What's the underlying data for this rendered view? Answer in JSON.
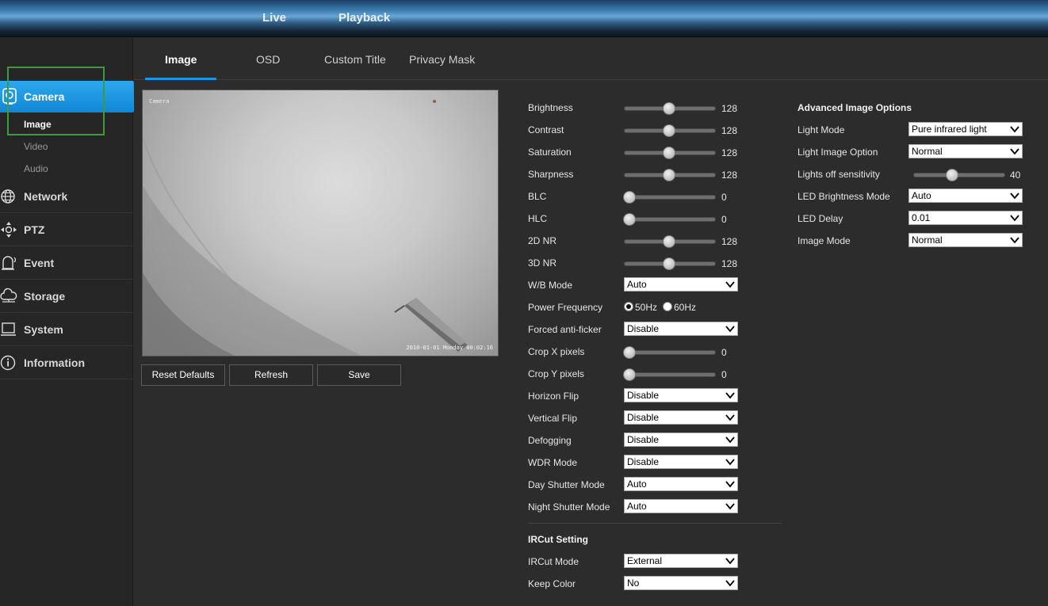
{
  "topnav": {
    "live": "Live",
    "playback": "Playback"
  },
  "sidebar": {
    "camera": "Camera",
    "camera_sub": [
      "Image",
      "Video",
      "Audio"
    ],
    "items": [
      "Network",
      "PTZ",
      "Event",
      "Storage",
      "System",
      "Information"
    ]
  },
  "tabs": [
    "Image",
    "OSD",
    "Custom Title",
    "Privacy Mask"
  ],
  "preview": {
    "osd_name": "Camera",
    "osd_time": "2010-01-01 Monday 00:02:16"
  },
  "buttons": {
    "reset": "Reset Defaults",
    "refresh": "Refresh",
    "save": "Save"
  },
  "sliders": [
    {
      "label": "Brightness",
      "value": "128",
      "fraction": 0.5
    },
    {
      "label": "Contrast",
      "value": "128",
      "fraction": 0.5
    },
    {
      "label": "Saturation",
      "value": "128",
      "fraction": 0.5
    },
    {
      "label": "Sharpness",
      "value": "128",
      "fraction": 0.5
    },
    {
      "label": "BLC",
      "value": "0",
      "fraction": 0
    },
    {
      "label": "HLC",
      "value": "0",
      "fraction": 0
    },
    {
      "label": "2D NR",
      "value": "128",
      "fraction": 0.5
    },
    {
      "label": "3D NR",
      "value": "128",
      "fraction": 0.5
    }
  ],
  "wb": {
    "label": "W/B Mode",
    "value": "Auto"
  },
  "power": {
    "label": "Power Frequency",
    "opt1": "50Hz",
    "opt2": "60Hz",
    "selected": "50Hz"
  },
  "antiflicker": {
    "label": "Forced anti-ficker",
    "value": "Disable"
  },
  "crop": [
    {
      "label": "Crop X pixels",
      "value": "0",
      "fraction": 0
    },
    {
      "label": "Crop Y pixels",
      "value": "0",
      "fraction": 0
    }
  ],
  "selects": [
    {
      "label": "Horizon Flip",
      "value": "Disable"
    },
    {
      "label": "Vertical Flip",
      "value": "Disable"
    },
    {
      "label": "Defogging",
      "value": "Disable"
    },
    {
      "label": "WDR Mode",
      "value": "Disable"
    },
    {
      "label": "Day Shutter Mode",
      "value": "Auto"
    },
    {
      "label": "Night Shutter Mode",
      "value": "Auto"
    }
  ],
  "ircut": {
    "title": "IRCut Setting",
    "mode_label": "IRCut Mode",
    "mode_value": "External",
    "color_label": "Keep Color",
    "color_value": "No"
  },
  "advanced": {
    "title": "Advanced Image Options",
    "light_mode_label": "Light Mode",
    "light_mode_value": "Pure infrared light",
    "light_image_label": "Light Image Option",
    "light_image_value": "Normal",
    "sensitivity_label": "Lights off sensitivity",
    "sensitivity_value": "40",
    "sensitivity_fraction": 0.4,
    "led_mode_label": "LED Brightness Mode",
    "led_mode_value": "Auto",
    "led_delay_label": "LED Delay",
    "led_delay_value": "0.01",
    "image_mode_label": "Image Mode",
    "image_mode_value": "Normal"
  },
  "colors": {
    "accent": "#1a96e0",
    "highlight_box": "#3d9a3d"
  }
}
